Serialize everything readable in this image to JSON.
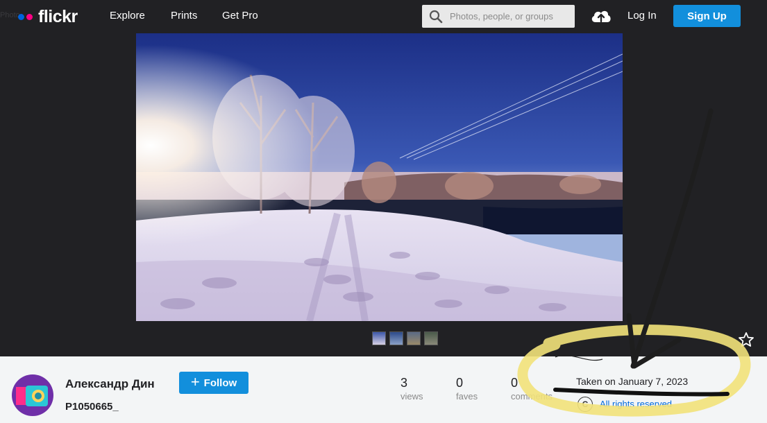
{
  "nav": {
    "ghost_text": "Photo",
    "logo_text": "flickr",
    "links": [
      "Explore",
      "Prints",
      "Get Pro"
    ],
    "search_placeholder": "Photos, people, or groups",
    "login_label": "Log In",
    "signup_label": "Sign Up"
  },
  "photo": {
    "thumbnail_count": 4
  },
  "owner": {
    "name": "Александр Дин",
    "follow_label": "Follow"
  },
  "photo_title": "P1050665_",
  "stats": [
    {
      "value": "3",
      "label": "views"
    },
    {
      "value": "0",
      "label": "faves"
    },
    {
      "value": "0",
      "label": "comments"
    }
  ],
  "meta": {
    "taken": "Taken on January 7, 2023",
    "copyright_symbol": "C",
    "rights": "All rights reserved"
  },
  "colors": {
    "nav_bg": "#212124",
    "accent": "#128fdc",
    "link": "#006add",
    "annotation_yellow": "#f2e27a"
  },
  "icons": [
    "search-icon",
    "upload-cloud-icon",
    "star-icon",
    "copyright-icon",
    "plus-icon"
  ]
}
